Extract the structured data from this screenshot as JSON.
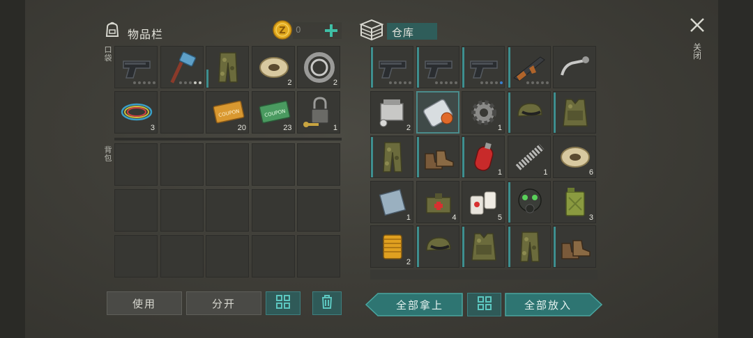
{
  "inventory": {
    "title": "物品栏",
    "coins": "0",
    "add_icon": "plus-icon",
    "pocket_label": "口袋",
    "backpack_label": "背包",
    "pocket_slots": [
      {
        "icon": "pistol-icon",
        "qty": "",
        "durability": "dots"
      },
      {
        "icon": "hammer-icon",
        "qty": "",
        "durability": "dots2"
      },
      {
        "icon": "camo-pants-icon",
        "qty": "",
        "durability": "bar"
      },
      {
        "icon": "wire-spool-icon",
        "qty": "2"
      },
      {
        "icon": "bearing-ring-icon",
        "qty": "2"
      },
      {
        "icon": "wire-coil-icon",
        "qty": "3"
      },
      {
        "icon": "",
        "qty": ""
      },
      {
        "icon": "coupon-orange-icon",
        "qty": "20"
      },
      {
        "icon": "coupon-green-icon",
        "qty": "23"
      },
      {
        "icon": "padlock-key-icon",
        "qty": "1"
      }
    ],
    "backpack_rows": 3,
    "backpack_cols": 5
  },
  "storage": {
    "title": "仓库",
    "icon": "storage-box-icon",
    "slots": [
      {
        "icon": "pistol-icon",
        "qty": "",
        "durability": "dots"
      },
      {
        "icon": "pistol-icon",
        "qty": "",
        "durability": "dots"
      },
      {
        "icon": "pistol-icon",
        "qty": "",
        "durability": "dotsblue"
      },
      {
        "icon": "rifle-icon",
        "qty": "",
        "durability": "dots"
      },
      {
        "icon": "handlebar-icon",
        "qty": ""
      },
      {
        "icon": "engine-block-icon",
        "qty": "2"
      },
      {
        "icon": "rolled-map-icon",
        "qty": "",
        "selected": true
      },
      {
        "icon": "gear-icon",
        "qty": "1"
      },
      {
        "icon": "camo-cap-icon",
        "qty": ""
      },
      {
        "icon": "camo-vest-icon",
        "qty": ""
      },
      {
        "icon": "camo-pants-icon",
        "qty": ""
      },
      {
        "icon": "boots-icon",
        "qty": ""
      },
      {
        "icon": "gas-canister-icon",
        "qty": "1"
      },
      {
        "icon": "spring-icon",
        "qty": "1"
      },
      {
        "icon": "wire-spool-icon",
        "qty": "6"
      },
      {
        "icon": "metal-plate-icon",
        "qty": "1"
      },
      {
        "icon": "medkit-bag-icon",
        "qty": "4"
      },
      {
        "icon": "bandage-icon",
        "qty": "5"
      },
      {
        "icon": "gas-mask-icon",
        "qty": ""
      },
      {
        "icon": "jerrycan-icon",
        "qty": "3"
      },
      {
        "icon": "oil-filter-icon",
        "qty": "2"
      },
      {
        "icon": "camo-cap-icon",
        "qty": ""
      },
      {
        "icon": "camo-vest-icon",
        "qty": ""
      },
      {
        "icon": "camo-pants-icon",
        "qty": ""
      },
      {
        "icon": "boots-icon",
        "qty": ""
      }
    ]
  },
  "buttons": {
    "use": "使用",
    "split": "分开",
    "sort_icon": "grid-sort-icon",
    "trash_icon": "trash-icon",
    "take_all": "全部拿上",
    "put_all": "全部放入"
  },
  "close": {
    "icon": "close-icon",
    "label": "关闭"
  },
  "colors": {
    "accent_teal": "#3e8f8f",
    "coin_gold": "#e0a81e",
    "plus_green": "#3fbfa6"
  }
}
